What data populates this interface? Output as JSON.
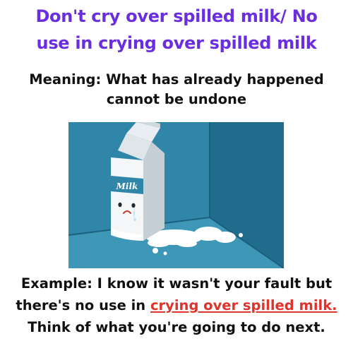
{
  "title": {
    "line1": "Don't cry over spilled milk/ No",
    "line2": "use in crying over spilled milk"
  },
  "meaning": {
    "line1": "Meaning: What has already happened",
    "line2": "cannot be undone"
  },
  "illustration": {
    "carton_label": "Milk"
  },
  "example": {
    "line1": "Example: I know it wasn't your fault but",
    "line2_before": "there's no use in ",
    "line2_highlight": "crying over spilled milk.",
    "line3": "Think of what you're going to do next."
  },
  "colors": {
    "title": "#6a2ee0",
    "highlight": "#e0332b",
    "body_text": "#111111",
    "wall_back": "#2f86a8",
    "wall_side": "#1f6c8c",
    "floor": "#3f97b8"
  }
}
